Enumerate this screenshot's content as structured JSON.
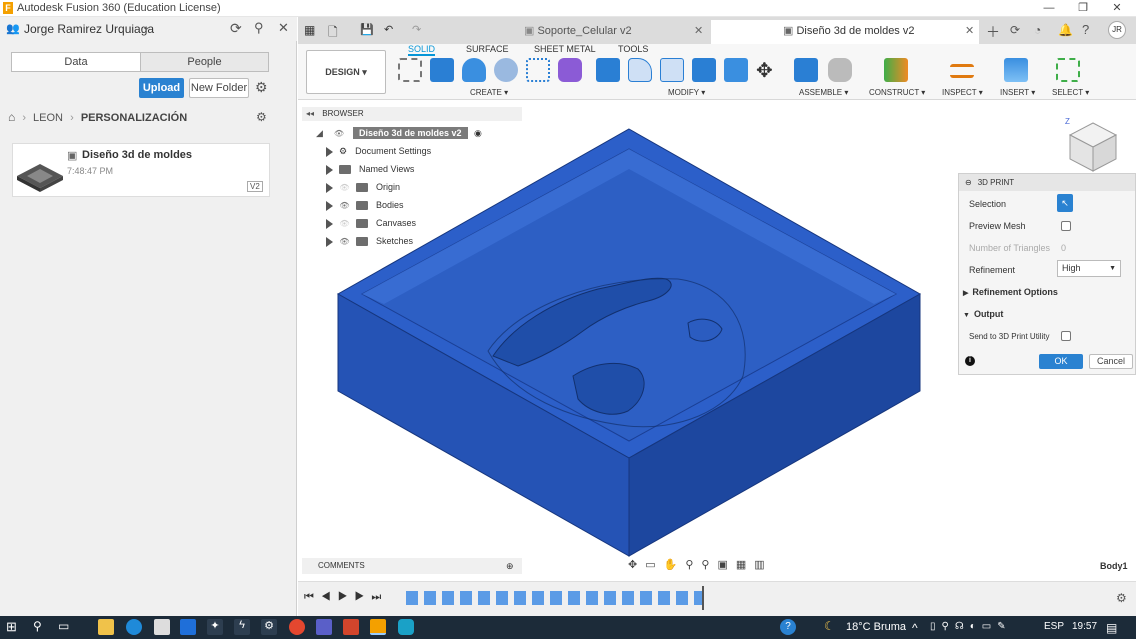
{
  "window": {
    "title": "Autodesk Fusion 360 (Education License)"
  },
  "user": {
    "name": "Jorge Ramirez Urquiaga",
    "initials": "JR"
  },
  "data_panel": {
    "tab_data": "Data",
    "tab_people": "People",
    "upload_label": "Upload",
    "new_folder_label": "New Folder",
    "breadcrumb": [
      "LEON",
      "PERSONALIZACIÓN"
    ],
    "file": {
      "name": "Diseño 3d de moldes",
      "time": "7:48:47 PM",
      "version": "V2"
    }
  },
  "doc_tabs": [
    {
      "label": "Soporte_Celular v2"
    },
    {
      "label": "Diseño 3d de moldes v2"
    }
  ],
  "ribbon": {
    "workspace": "DESIGN",
    "tabs": [
      "SOLID",
      "SURFACE",
      "SHEET METAL",
      "TOOLS"
    ],
    "groups": [
      "CREATE",
      "MODIFY",
      "ASSEMBLE",
      "CONSTRUCT",
      "INSPECT",
      "INSERT",
      "SELECT"
    ]
  },
  "browser": {
    "title": "BROWSER",
    "root": "Diseño 3d de moldes v2",
    "items": [
      "Document Settings",
      "Named Views",
      "Origin",
      "Bodies",
      "Canvases",
      "Sketches"
    ]
  },
  "comments": {
    "title": "COMMENTS"
  },
  "print_panel": {
    "title": "3D PRINT",
    "selection_label": "Selection",
    "preview_mesh_label": "Preview Mesh",
    "triangles_label": "Number of Triangles",
    "triangles_value": "0",
    "refinement_label": "Refinement",
    "refinement_value": "High",
    "refinement_options_label": "Refinement Options",
    "output_label": "Output",
    "send_label": "Send to 3D Print Utility",
    "ok_label": "OK",
    "cancel_label": "Cancel"
  },
  "status": {
    "selection": "Body1"
  },
  "taskbar": {
    "weather": "18°C Bruma",
    "lang": "ESP",
    "time": "19:57"
  },
  "colors": {
    "accent": "#0696d7",
    "body": "#1f4fb8",
    "taskbar": "#1c2b39"
  }
}
